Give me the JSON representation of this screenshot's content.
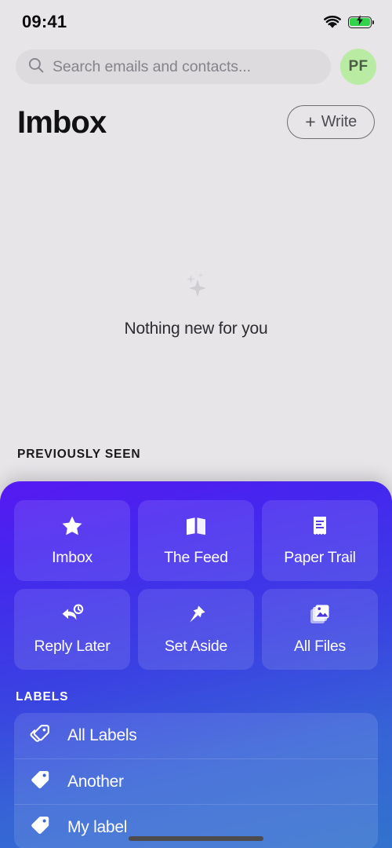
{
  "status_bar": {
    "time": "09:41",
    "wifi_icon": "wifi-icon",
    "battery_icon": "battery-charging-icon"
  },
  "search": {
    "placeholder": "Search emails and contacts...",
    "icon": "search-icon",
    "avatar_initials": "PF"
  },
  "header": {
    "title": "Imbox",
    "write_plus": "+",
    "write_label": "Write"
  },
  "empty_state": {
    "icon": "sparkles-icon",
    "message": "Nothing new for you"
  },
  "previously_seen": {
    "heading": "PREVIOUSLY SEEN"
  },
  "sheet": {
    "tiles": [
      {
        "label": "Imbox",
        "icon": "star-icon"
      },
      {
        "label": "The Feed",
        "icon": "open-book-icon"
      },
      {
        "label": "Paper Trail",
        "icon": "receipt-icon"
      },
      {
        "label": "Reply Later",
        "icon": "reply-clock-icon"
      },
      {
        "label": "Set Aside",
        "icon": "pushpin-icon"
      },
      {
        "label": "All Files",
        "icon": "images-stack-icon"
      }
    ],
    "labels_heading": "LABELS",
    "labels": [
      {
        "label": "All Labels",
        "icon": "double-tag-icon"
      },
      {
        "label": "Another",
        "icon": "tag-icon"
      },
      {
        "label": "My label",
        "icon": "tag-icon"
      }
    ]
  },
  "colors": {
    "background": "#e7e5e8",
    "sheet_top": "#5719f2",
    "sheet_bottom": "#3272cd",
    "avatar_bg": "#b9eba3",
    "battery_green": "#31d34a"
  }
}
